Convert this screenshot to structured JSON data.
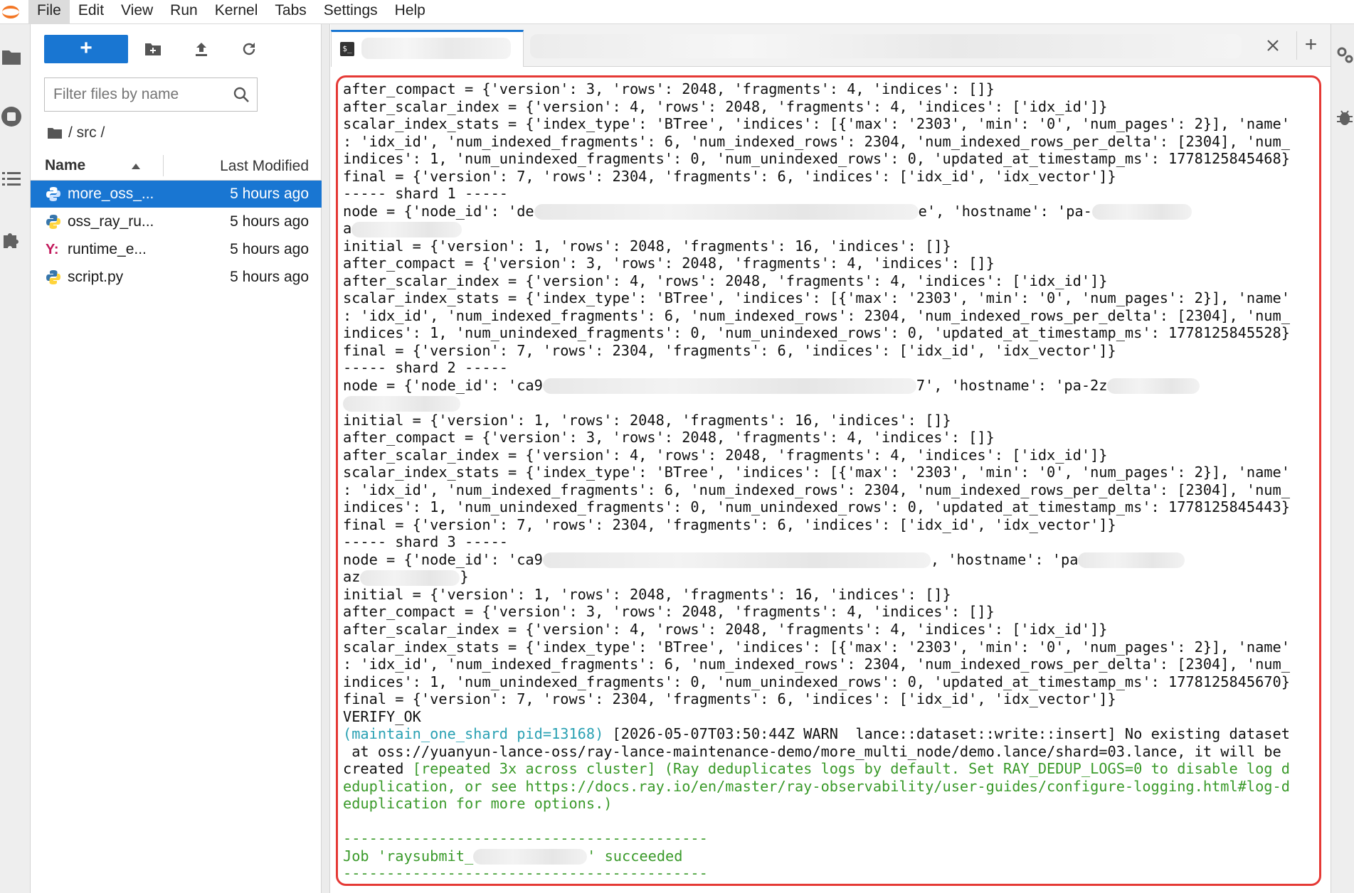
{
  "menu": [
    "File",
    "Edit",
    "View",
    "Run",
    "Kernel",
    "Tabs",
    "Settings",
    "Help"
  ],
  "file_browser": {
    "new_button_label": "+",
    "filter_placeholder": "Filter files by name",
    "breadcrumb": "/ src /",
    "col_name": "Name",
    "col_modified": "Last Modified",
    "files": [
      {
        "name": "more_oss_...",
        "modified": "5 hours ago",
        "icon": "python-icon",
        "selected": true
      },
      {
        "name": "oss_ray_ru...",
        "modified": "5 hours ago",
        "icon": "python-icon",
        "selected": false
      },
      {
        "name": "runtime_e...",
        "modified": "5 hours ago",
        "icon": "yaml-icon",
        "selected": false
      },
      {
        "name": "script.py",
        "modified": "5 hours ago",
        "icon": "python-icon",
        "selected": false
      }
    ]
  },
  "tabs": {
    "terminal_icon": "$_",
    "close_icon": "close-icon",
    "add_label": "+"
  },
  "terminal": {
    "lines": [
      [
        {
          "t": "after_compact = {'version': 3, 'rows': 2048, 'fragments': 4, 'indices': []}"
        }
      ],
      [
        {
          "t": "after_scalar_index = {'version': 4, 'rows': 2048, 'fragments': 4, 'indices': ['idx_id']}"
        }
      ],
      [
        {
          "t": "scalar_index_stats = {'index_type': 'BTree', 'indices': [{'max': '2303', 'min': '0', 'num_pages': 2}], 'name'"
        }
      ],
      [
        {
          "t": ": 'idx_id', 'num_indexed_fragments': 6, 'num_indexed_rows': 2304, 'num_indexed_rows_per_delta': [2304], 'num_"
        }
      ],
      [
        {
          "t": "indices': 1, 'num_unindexed_fragments': 0, 'num_unindexed_rows': 0, 'updated_at_timestamp_ms': 1778125845468}"
        }
      ],
      [
        {
          "t": "final = {'version': 7, 'rows': 2304, 'fragments': 6, 'indices': ['idx_id', 'idx_vector']}"
        }
      ],
      [
        {
          "t": "----- shard 1 -----"
        }
      ],
      [
        {
          "t": "node = {'node_id': 'de"
        },
        {
          "blur": 540
        },
        {
          "t": "e', 'hostname': 'pa-"
        },
        {
          "blur": 140
        }
      ],
      [
        {
          "t": "a"
        },
        {
          "blur": 155
        }
      ],
      [
        {
          "t": "initial = {'version': 1, 'rows': 2048, 'fragments': 16, 'indices': []}"
        }
      ],
      [
        {
          "t": "after_compact = {'version': 3, 'rows': 2048, 'fragments': 4, 'indices': []}"
        }
      ],
      [
        {
          "t": "after_scalar_index = {'version': 4, 'rows': 2048, 'fragments': 4, 'indices': ['idx_id']}"
        }
      ],
      [
        {
          "t": "scalar_index_stats = {'index_type': 'BTree', 'indices': [{'max': '2303', 'min': '0', 'num_pages': 2}], 'name'"
        }
      ],
      [
        {
          "t": ": 'idx_id', 'num_indexed_fragments': 6, 'num_indexed_rows': 2304, 'num_indexed_rows_per_delta': [2304], 'num_"
        }
      ],
      [
        {
          "t": "indices': 1, 'num_unindexed_fragments': 0, 'num_unindexed_rows': 0, 'updated_at_timestamp_ms': 1778125845528}"
        }
      ],
      [
        {
          "t": "final = {'version': 7, 'rows': 2304, 'fragments': 6, 'indices': ['idx_id', 'idx_vector']}"
        }
      ],
      [
        {
          "t": "----- shard 2 -----"
        }
      ],
      [
        {
          "t": "node = {'node_id': 'ca9"
        },
        {
          "blur": 525
        },
        {
          "t": "7', 'hostname': 'pa-2z"
        },
        {
          "blur": 130
        }
      ],
      [
        {
          "blur": 165
        }
      ],
      [
        {
          "t": "initial = {'version': 1, 'rows': 2048, 'fragments': 16, 'indices': []}"
        }
      ],
      [
        {
          "t": "after_compact = {'version': 3, 'rows': 2048, 'fragments': 4, 'indices': []}"
        }
      ],
      [
        {
          "t": "after_scalar_index = {'version': 4, 'rows': 2048, 'fragments': 4, 'indices': ['idx_id']}"
        }
      ],
      [
        {
          "t": "scalar_index_stats = {'index_type': 'BTree', 'indices': [{'max': '2303', 'min': '0', 'num_pages': 2}], 'name'"
        }
      ],
      [
        {
          "t": ": 'idx_id', 'num_indexed_fragments': 6, 'num_indexed_rows': 2304, 'num_indexed_rows_per_delta': [2304], 'num_"
        }
      ],
      [
        {
          "t": "indices': 1, 'num_unindexed_fragments': 0, 'num_unindexed_rows': 0, 'updated_at_timestamp_ms': 1778125845443}"
        }
      ],
      [
        {
          "t": "final = {'version': 7, 'rows': 2304, 'fragments': 6, 'indices': ['idx_id', 'idx_vector']}"
        }
      ],
      [
        {
          "t": "----- shard 3 -----"
        }
      ],
      [
        {
          "t": "node = {'node_id': 'ca9"
        },
        {
          "blur": 545
        },
        {
          "t": ", 'hostname': 'pa"
        },
        {
          "blur": 150
        }
      ],
      [
        {
          "t": "az"
        },
        {
          "blur": 140
        },
        {
          "t": "}"
        }
      ],
      [
        {
          "t": "initial = {'version': 1, 'rows': 2048, 'fragments': 16, 'indices': []}"
        }
      ],
      [
        {
          "t": "after_compact = {'version': 3, 'rows': 2048, 'fragments': 4, 'indices': []}"
        }
      ],
      [
        {
          "t": "after_scalar_index = {'version': 4, 'rows': 2048, 'fragments': 4, 'indices': ['idx_id']}"
        }
      ],
      [
        {
          "t": "scalar_index_stats = {'index_type': 'BTree', 'indices': [{'max': '2303', 'min': '0', 'num_pages': 2}], 'name'"
        }
      ],
      [
        {
          "t": ": 'idx_id', 'num_indexed_fragments': 6, 'num_indexed_rows': 2304, 'num_indexed_rows_per_delta': [2304], 'num_"
        }
      ],
      [
        {
          "t": "indices': 1, 'num_unindexed_fragments': 0, 'num_unindexed_rows': 0, 'updated_at_timestamp_ms': 1778125845670}"
        }
      ],
      [
        {
          "t": "final = {'version': 7, 'rows': 2304, 'fragments': 6, 'indices': ['idx_id', 'idx_vector']}"
        }
      ],
      [
        {
          "t": "VERIFY_OK"
        }
      ],
      [
        {
          "t": "(maintain_one_shard pid=13168)",
          "s": "c"
        },
        {
          "t": " [2026-05-07T03:50:44Z WARN  lance::dataset::write::insert] No existing dataset"
        }
      ],
      [
        {
          "t": " at oss://yuanyun-lance-oss/ray-lance-maintenance-demo/more_multi_node/demo.lance/shard=03.lance, it will be"
        }
      ],
      [
        {
          "t": "created "
        },
        {
          "t": "[repeated 3x across cluster] (Ray deduplicates logs by default. Set RAY_DEDUP_LOGS=0 to disable log d",
          "s": "g"
        }
      ],
      [
        {
          "t": "eduplication, or see https://docs.ray.io/en/master/ray-observability/user-guides/configure-logging.html#log-d",
          "s": "g"
        }
      ],
      [
        {
          "t": "eduplication for more options.)",
          "s": "g"
        }
      ],
      [
        {
          "t": ""
        }
      ],
      [
        {
          "t": "------------------------------------------",
          "s": "g"
        }
      ],
      [
        {
          "t": "Job 'raysubmit_",
          "s": "g"
        },
        {
          "blur": 160
        },
        {
          "t": "' succeeded",
          "s": "g"
        }
      ],
      [
        {
          "t": "------------------------------------------",
          "s": "g"
        }
      ]
    ]
  },
  "colors": {
    "accent": "#1976d2",
    "highlight_border": "#e53935",
    "log_green": "#3a9a2a",
    "log_cyan": "#2aa1b3"
  }
}
